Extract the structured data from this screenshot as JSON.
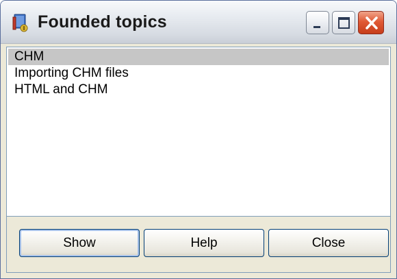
{
  "window": {
    "title": "Founded topics",
    "icon": "help-book-icon"
  },
  "titlebar_buttons": {
    "minimize_icon": "minimize-icon",
    "maximize_icon": "maximize-icon",
    "close_icon": "close-icon"
  },
  "topics": {
    "items": [
      {
        "label": "CHM",
        "selected": true
      },
      {
        "label": "Importing CHM files",
        "selected": false
      },
      {
        "label": "HTML and CHM",
        "selected": false
      }
    ]
  },
  "buttons": {
    "show_label": "Show",
    "help_label": "Help",
    "close_label": "Close"
  },
  "colors": {
    "selection": "#c6c6c6",
    "close_button": "#d9532f",
    "button_border": "#003c74"
  }
}
